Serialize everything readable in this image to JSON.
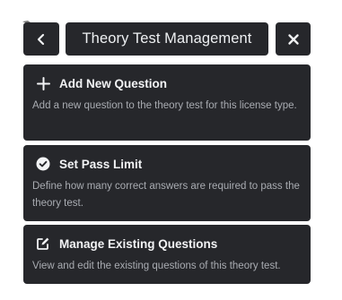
{
  "header": {
    "title": "Theory Test Management"
  },
  "icons": {
    "back": "chevron-left-icon",
    "close": "close-icon",
    "add": "plus-icon",
    "pass": "check-circle-icon",
    "manage": "edit-icon"
  },
  "cards": [
    {
      "title": "Add New Question",
      "description": "Add a new question to the theory test for this license type."
    },
    {
      "title": "Set Pass Limit",
      "description": "Define how many correct answers are required to pass the theory test."
    },
    {
      "title": "Manage Existing Questions",
      "description": "View and edit the existing questions of this theory test."
    }
  ],
  "colors": {
    "panel": "#26272b",
    "title_text": "#f2f3f5",
    "description_text": "#a9acb2",
    "background": "#ffffff"
  }
}
